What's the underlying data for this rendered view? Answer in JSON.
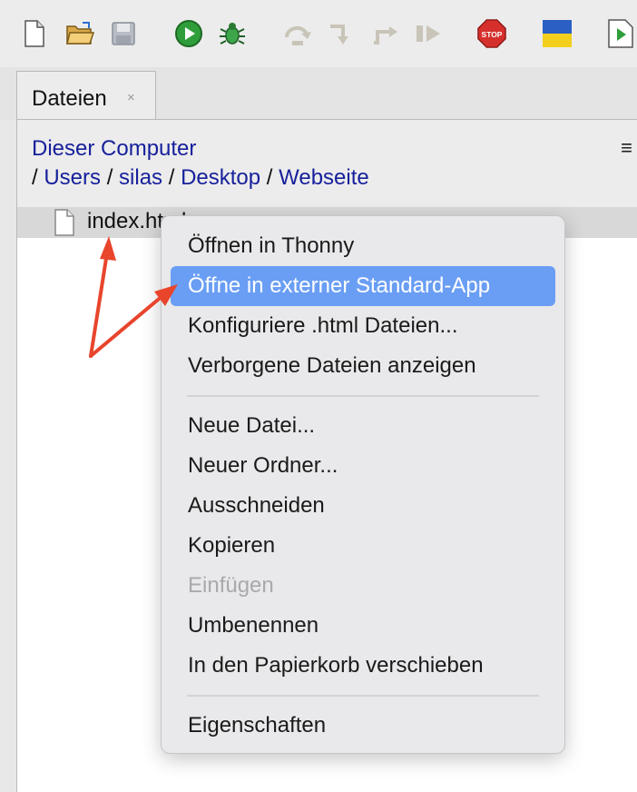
{
  "toolbar": {
    "buttons": [
      {
        "icon": "new-file-icon"
      },
      {
        "icon": "open-folder-icon"
      },
      {
        "icon": "save-icon"
      },
      {
        "icon": "run-icon"
      },
      {
        "icon": "debug-bug-icon"
      },
      {
        "icon": "step-over-icon"
      },
      {
        "icon": "step-into-icon"
      },
      {
        "icon": "step-out-icon"
      },
      {
        "icon": "resume-icon"
      },
      {
        "icon": "stop-icon",
        "label": "STOP"
      },
      {
        "icon": "ukraine-flag-icon"
      },
      {
        "icon": "run-page-icon"
      }
    ]
  },
  "tab": {
    "label": "Dateien",
    "close": "×"
  },
  "breadcrumb": {
    "root": "Dieser Computer",
    "separator": "/",
    "parts": [
      "Users",
      "silas",
      "Desktop",
      "Webseite"
    ],
    "menu_glyph": "≡"
  },
  "file": {
    "name": "index.html"
  },
  "context_menu": {
    "items": [
      {
        "label": "Öffnen in Thonny"
      },
      {
        "label": "Öffne in externer Standard-App"
      },
      {
        "label": "Konfiguriere .html Dateien..."
      },
      {
        "label": "Verborgene Dateien anzeigen"
      },
      {
        "label": "Neue Datei..."
      },
      {
        "label": "Neuer Ordner..."
      },
      {
        "label": "Ausschneiden"
      },
      {
        "label": "Kopieren"
      },
      {
        "label": "Einfügen"
      },
      {
        "label": "Umbenennen"
      },
      {
        "label": "In den Papierkorb verschieben"
      },
      {
        "label": "Eigenschaften"
      }
    ]
  },
  "colors": {
    "highlight": "#6a9ef4",
    "link": "#17219b",
    "arrow": "#e8452c",
    "disabled": "#a9a9ab"
  }
}
